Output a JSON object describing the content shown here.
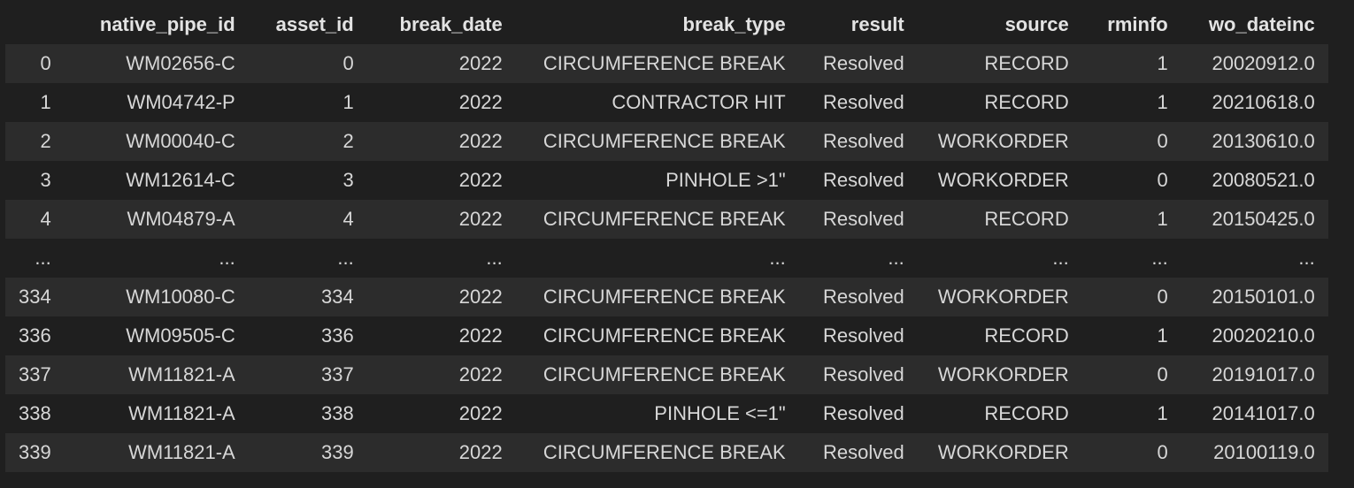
{
  "table": {
    "columns": [
      "",
      "native_pipe_id",
      "asset_id",
      "break_date",
      "break_type",
      "result",
      "source",
      "rminfo",
      "wo_dateinc"
    ],
    "rows": [
      [
        "0",
        "WM02656-C",
        "0",
        "2022",
        "CIRCUMFERENCE BREAK",
        "Resolved",
        "RECORD",
        "1",
        "20020912.0"
      ],
      [
        "1",
        "WM04742-P",
        "1",
        "2022",
        "CONTRACTOR HIT",
        "Resolved",
        "RECORD",
        "1",
        "20210618.0"
      ],
      [
        "2",
        "WM00040-C",
        "2",
        "2022",
        "CIRCUMFERENCE BREAK",
        "Resolved",
        "WORKORDER",
        "0",
        "20130610.0"
      ],
      [
        "3",
        "WM12614-C",
        "3",
        "2022",
        "PINHOLE >1\"",
        "Resolved",
        "WORKORDER",
        "0",
        "20080521.0"
      ],
      [
        "4",
        "WM04879-A",
        "4",
        "2022",
        "CIRCUMFERENCE BREAK",
        "Resolved",
        "RECORD",
        "1",
        "20150425.0"
      ],
      [
        "...",
        "...",
        "...",
        "...",
        "...",
        "...",
        "...",
        "...",
        "..."
      ],
      [
        "334",
        "WM10080-C",
        "334",
        "2022",
        "CIRCUMFERENCE BREAK",
        "Resolved",
        "WORKORDER",
        "0",
        "20150101.0"
      ],
      [
        "336",
        "WM09505-C",
        "336",
        "2022",
        "CIRCUMFERENCE BREAK",
        "Resolved",
        "RECORD",
        "1",
        "20020210.0"
      ],
      [
        "337",
        "WM11821-A",
        "337",
        "2022",
        "CIRCUMFERENCE BREAK",
        "Resolved",
        "WORKORDER",
        "0",
        "20191017.0"
      ],
      [
        "338",
        "WM11821-A",
        "338",
        "2022",
        "PINHOLE <=1\"",
        "Resolved",
        "RECORD",
        "1",
        "20141017.0"
      ],
      [
        "339",
        "WM11821-A",
        "339",
        "2022",
        "CIRCUMFERENCE BREAK",
        "Resolved",
        "WORKORDER",
        "0",
        "20100119.0"
      ]
    ]
  },
  "colors": {
    "background": "#1f1f1f",
    "row_stripe": "#2c2c2c",
    "text": "#d7d7d7"
  }
}
